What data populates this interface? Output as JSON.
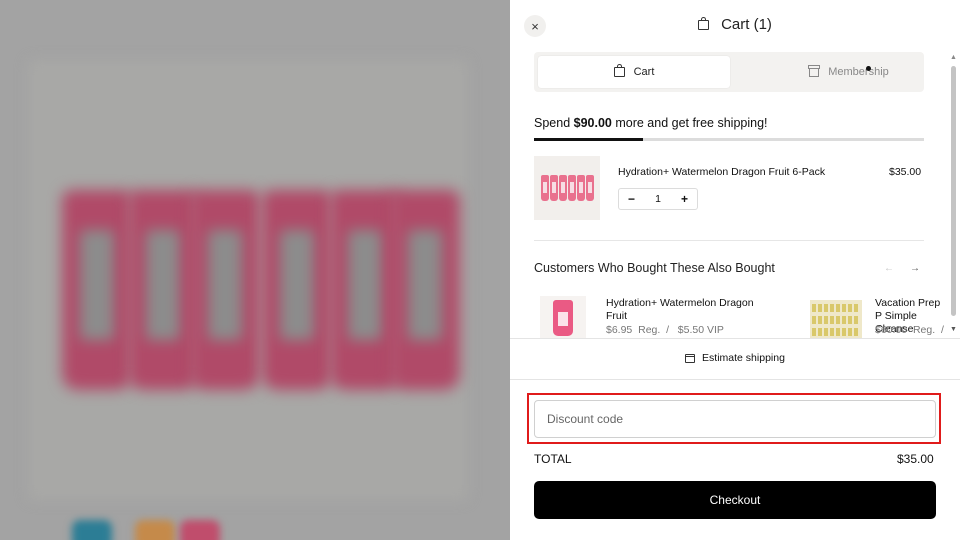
{
  "header": {
    "title": "Cart (1)",
    "close_icon": "×"
  },
  "tabs": [
    {
      "label": "Cart",
      "icon": "bag-icon",
      "active": true
    },
    {
      "label": "Membership",
      "icon": "gift-icon",
      "active": false,
      "has_notification": true
    }
  ],
  "shipping": {
    "prefix": "Spend ",
    "amount": "$90.00",
    "suffix": " more and get free shipping!",
    "progress_fraction": 0.28
  },
  "cart_item": {
    "name": "Hydration+ Watermelon Dragon Fruit 6-Pack",
    "price": "$35.00",
    "quantity": "1",
    "decrement": "−",
    "increment": "+"
  },
  "recommendations": {
    "title": "Customers Who Bought These Also Bought",
    "prev_arrow": "←",
    "next_arrow": "→",
    "items": [
      {
        "name": "Hydration+ Watermelon Dragon Fruit",
        "price_line": "$6.95  Reg.  /   $5.50 VIP"
      },
      {
        "name": "Vacation Prep P Simple Cleanse",
        "price_line": "$60.00  Reg.  /"
      }
    ]
  },
  "estimate_shipping": {
    "label": "Estimate shipping",
    "icon": "calendar-icon"
  },
  "discount": {
    "placeholder": "Discount code",
    "value": ""
  },
  "total": {
    "label": "TOTAL",
    "value": "$35.00"
  },
  "checkout": {
    "label": "Checkout"
  },
  "colors": {
    "accent": "#000000",
    "highlight_border": "#e01b1b",
    "progress_track": "#dcdcdc"
  }
}
